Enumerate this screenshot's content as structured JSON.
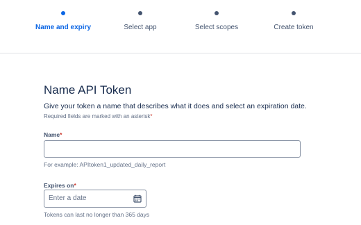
{
  "stepper": {
    "steps": [
      {
        "label": "Name and expiry",
        "active": true
      },
      {
        "label": "Select app",
        "active": false
      },
      {
        "label": "Select scopes",
        "active": false
      },
      {
        "label": "Create token",
        "active": false
      }
    ]
  },
  "form": {
    "title": "Name API Token",
    "description": "Give your token a name that describes what it does and select an expiration date.",
    "required_note": "Required fields are marked with an asterisk",
    "required_star": "*",
    "name": {
      "label": "Name",
      "value": "",
      "help": "For example: APItoken1_updated_daily_report"
    },
    "expires": {
      "label": "Expires on",
      "placeholder": "Enter a date",
      "help": "Tokens can last no longer than 365 days",
      "icon": "calendar-icon"
    }
  },
  "colors": {
    "accent": "#0c66e4",
    "required": "#c9372c",
    "text": "#172b4d",
    "subtle": "#626f86"
  }
}
